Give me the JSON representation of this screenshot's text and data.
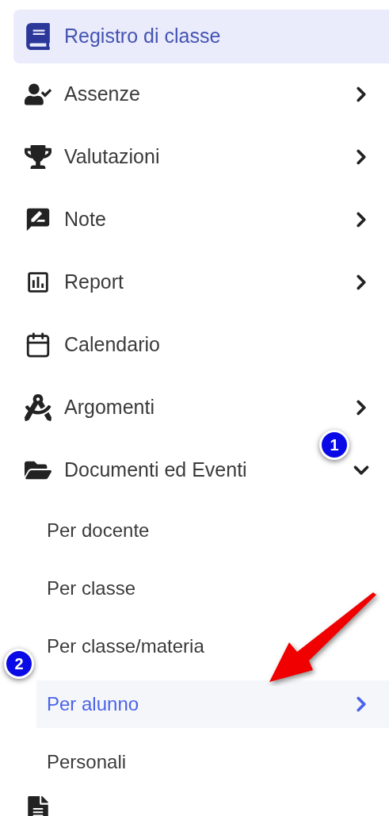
{
  "menu": [
    {
      "label": "Registro di classe",
      "selected": true
    },
    {
      "label": "Assenze",
      "selected": false,
      "expanded": false
    },
    {
      "label": "Valutazioni",
      "selected": false,
      "expanded": false
    },
    {
      "label": "Note",
      "selected": false,
      "expanded": false
    },
    {
      "label": "Report",
      "selected": false,
      "expanded": false
    },
    {
      "label": "Calendario",
      "selected": false
    },
    {
      "label": "Argomenti",
      "selected": false,
      "expanded": false
    },
    {
      "label": "Documenti ed Eventi",
      "selected": false,
      "expanded": true,
      "children": [
        {
          "label": "Per docente",
          "selected": false
        },
        {
          "label": "Per classe",
          "selected": false
        },
        {
          "label": "Per classe/materia",
          "selected": false
        },
        {
          "label": "Per alunno",
          "selected": true,
          "expanded": false
        },
        {
          "label": "Personali",
          "selected": false
        }
      ]
    }
  ],
  "annotations": [
    {
      "label": "1"
    },
    {
      "label": "2"
    }
  ]
}
